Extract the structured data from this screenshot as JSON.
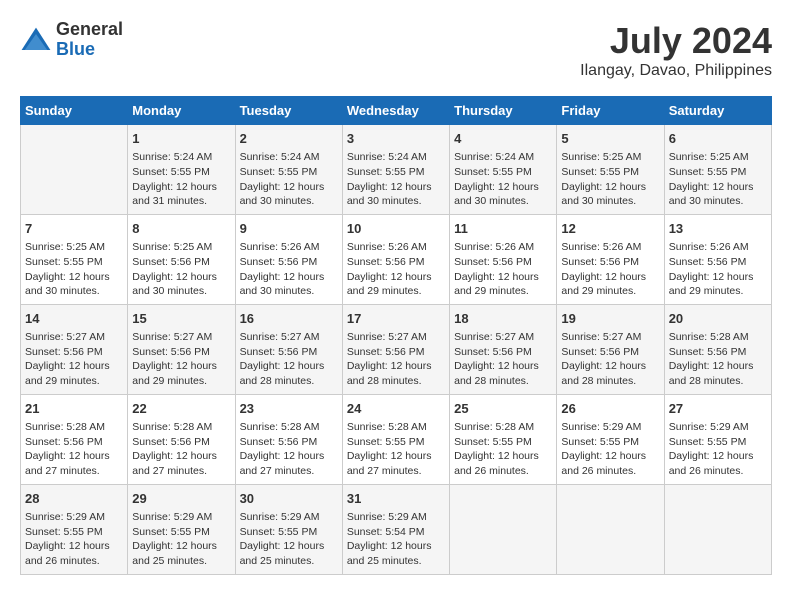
{
  "logo": {
    "general": "General",
    "blue": "Blue"
  },
  "title": "July 2024",
  "subtitle": "Ilangay, Davao, Philippines",
  "days_header": [
    "Sunday",
    "Monday",
    "Tuesday",
    "Wednesday",
    "Thursday",
    "Friday",
    "Saturday"
  ],
  "weeks": [
    [
      {
        "day": "",
        "info": ""
      },
      {
        "day": "1",
        "info": "Sunrise: 5:24 AM\nSunset: 5:55 PM\nDaylight: 12 hours\nand 31 minutes."
      },
      {
        "day": "2",
        "info": "Sunrise: 5:24 AM\nSunset: 5:55 PM\nDaylight: 12 hours\nand 30 minutes."
      },
      {
        "day": "3",
        "info": "Sunrise: 5:24 AM\nSunset: 5:55 PM\nDaylight: 12 hours\nand 30 minutes."
      },
      {
        "day": "4",
        "info": "Sunrise: 5:24 AM\nSunset: 5:55 PM\nDaylight: 12 hours\nand 30 minutes."
      },
      {
        "day": "5",
        "info": "Sunrise: 5:25 AM\nSunset: 5:55 PM\nDaylight: 12 hours\nand 30 minutes."
      },
      {
        "day": "6",
        "info": "Sunrise: 5:25 AM\nSunset: 5:55 PM\nDaylight: 12 hours\nand 30 minutes."
      }
    ],
    [
      {
        "day": "7",
        "info": "Sunrise: 5:25 AM\nSunset: 5:55 PM\nDaylight: 12 hours\nand 30 minutes."
      },
      {
        "day": "8",
        "info": "Sunrise: 5:25 AM\nSunset: 5:56 PM\nDaylight: 12 hours\nand 30 minutes."
      },
      {
        "day": "9",
        "info": "Sunrise: 5:26 AM\nSunset: 5:56 PM\nDaylight: 12 hours\nand 30 minutes."
      },
      {
        "day": "10",
        "info": "Sunrise: 5:26 AM\nSunset: 5:56 PM\nDaylight: 12 hours\nand 29 minutes."
      },
      {
        "day": "11",
        "info": "Sunrise: 5:26 AM\nSunset: 5:56 PM\nDaylight: 12 hours\nand 29 minutes."
      },
      {
        "day": "12",
        "info": "Sunrise: 5:26 AM\nSunset: 5:56 PM\nDaylight: 12 hours\nand 29 minutes."
      },
      {
        "day": "13",
        "info": "Sunrise: 5:26 AM\nSunset: 5:56 PM\nDaylight: 12 hours\nand 29 minutes."
      }
    ],
    [
      {
        "day": "14",
        "info": "Sunrise: 5:27 AM\nSunset: 5:56 PM\nDaylight: 12 hours\nand 29 minutes."
      },
      {
        "day": "15",
        "info": "Sunrise: 5:27 AM\nSunset: 5:56 PM\nDaylight: 12 hours\nand 29 minutes."
      },
      {
        "day": "16",
        "info": "Sunrise: 5:27 AM\nSunset: 5:56 PM\nDaylight: 12 hours\nand 28 minutes."
      },
      {
        "day": "17",
        "info": "Sunrise: 5:27 AM\nSunset: 5:56 PM\nDaylight: 12 hours\nand 28 minutes."
      },
      {
        "day": "18",
        "info": "Sunrise: 5:27 AM\nSunset: 5:56 PM\nDaylight: 12 hours\nand 28 minutes."
      },
      {
        "day": "19",
        "info": "Sunrise: 5:27 AM\nSunset: 5:56 PM\nDaylight: 12 hours\nand 28 minutes."
      },
      {
        "day": "20",
        "info": "Sunrise: 5:28 AM\nSunset: 5:56 PM\nDaylight: 12 hours\nand 28 minutes."
      }
    ],
    [
      {
        "day": "21",
        "info": "Sunrise: 5:28 AM\nSunset: 5:56 PM\nDaylight: 12 hours\nand 27 minutes."
      },
      {
        "day": "22",
        "info": "Sunrise: 5:28 AM\nSunset: 5:56 PM\nDaylight: 12 hours\nand 27 minutes."
      },
      {
        "day": "23",
        "info": "Sunrise: 5:28 AM\nSunset: 5:56 PM\nDaylight: 12 hours\nand 27 minutes."
      },
      {
        "day": "24",
        "info": "Sunrise: 5:28 AM\nSunset: 5:55 PM\nDaylight: 12 hours\nand 27 minutes."
      },
      {
        "day": "25",
        "info": "Sunrise: 5:28 AM\nSunset: 5:55 PM\nDaylight: 12 hours\nand 26 minutes."
      },
      {
        "day": "26",
        "info": "Sunrise: 5:29 AM\nSunset: 5:55 PM\nDaylight: 12 hours\nand 26 minutes."
      },
      {
        "day": "27",
        "info": "Sunrise: 5:29 AM\nSunset: 5:55 PM\nDaylight: 12 hours\nand 26 minutes."
      }
    ],
    [
      {
        "day": "28",
        "info": "Sunrise: 5:29 AM\nSunset: 5:55 PM\nDaylight: 12 hours\nand 26 minutes."
      },
      {
        "day": "29",
        "info": "Sunrise: 5:29 AM\nSunset: 5:55 PM\nDaylight: 12 hours\nand 25 minutes."
      },
      {
        "day": "30",
        "info": "Sunrise: 5:29 AM\nSunset: 5:55 PM\nDaylight: 12 hours\nand 25 minutes."
      },
      {
        "day": "31",
        "info": "Sunrise: 5:29 AM\nSunset: 5:54 PM\nDaylight: 12 hours\nand 25 minutes."
      },
      {
        "day": "",
        "info": ""
      },
      {
        "day": "",
        "info": ""
      },
      {
        "day": "",
        "info": ""
      }
    ]
  ]
}
